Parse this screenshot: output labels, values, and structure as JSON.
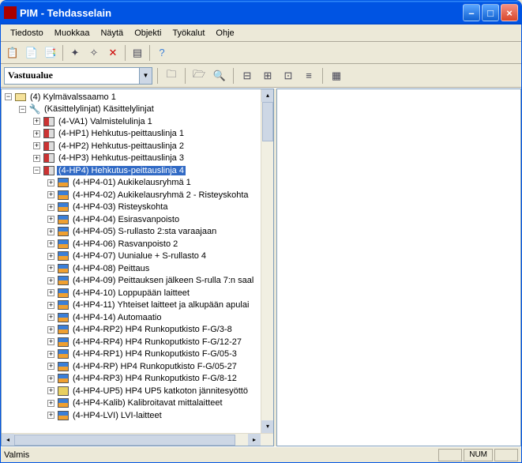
{
  "title": "PIM - Tehdasselain",
  "menu": [
    "Tiedosto",
    "Muokkaa",
    "Näytä",
    "Objekti",
    "Työkalut",
    "Ohje"
  ],
  "combo": "Vastuualue",
  "status": {
    "ready": "Valmis",
    "num": "NUM"
  },
  "tree": [
    {
      "depth": 0,
      "exp": "-",
      "icon": "root",
      "text": "(4) Kylmävalssaamo 1"
    },
    {
      "depth": 1,
      "exp": "-",
      "icon": "wrench",
      "text": "(Käsittelylinjat)  Käsittelylinjat"
    },
    {
      "depth": 2,
      "exp": "+",
      "icon": "factory",
      "text": "(4-VA1)  Valmistelulinja 1"
    },
    {
      "depth": 2,
      "exp": "+",
      "icon": "factory",
      "text": "(4-HP1)  Hehkutus-peittauslinja 1"
    },
    {
      "depth": 2,
      "exp": "+",
      "icon": "factory",
      "text": "(4-HP2)  Hehkutus-peittauslinja 2"
    },
    {
      "depth": 2,
      "exp": "+",
      "icon": "factory",
      "text": "(4-HP3)  Hehkutus-peittauslinja 3"
    },
    {
      "depth": 2,
      "exp": "-",
      "icon": "factory",
      "text": "(4-HP4)  Hehkutus-peittauslinja 4",
      "selected": true
    },
    {
      "depth": 3,
      "exp": "+",
      "icon": "equip",
      "text": "(4-HP4-01)  Aukikelausryhmä 1"
    },
    {
      "depth": 3,
      "exp": "+",
      "icon": "equip",
      "text": "(4-HP4-02)  Aukikelausryhmä 2 - Risteyskohta"
    },
    {
      "depth": 3,
      "exp": "+",
      "icon": "equip",
      "text": "(4-HP4-03)  Risteyskohta"
    },
    {
      "depth": 3,
      "exp": "+",
      "icon": "equip",
      "text": "(4-HP4-04)  Esirasvanpoisto"
    },
    {
      "depth": 3,
      "exp": "+",
      "icon": "equip",
      "text": "(4-HP4-05)  S-rullasto 2:sta varaajaan"
    },
    {
      "depth": 3,
      "exp": "+",
      "icon": "equip",
      "text": "(4-HP4-06)  Rasvanpoisto 2"
    },
    {
      "depth": 3,
      "exp": "+",
      "icon": "equip",
      "text": "(4-HP4-07)  Uunialue + S-rullasto 4"
    },
    {
      "depth": 3,
      "exp": "+",
      "icon": "equip",
      "text": "(4-HP4-08)  Peittaus"
    },
    {
      "depth": 3,
      "exp": "+",
      "icon": "equip",
      "text": "(4-HP4-09)  Peittauksen jälkeen S-rulla 7:n saal"
    },
    {
      "depth": 3,
      "exp": "+",
      "icon": "equip",
      "text": "(4-HP4-10)  Loppupään laitteet"
    },
    {
      "depth": 3,
      "exp": "+",
      "icon": "equip",
      "text": "(4-HP4-11)  Yhteiset laitteet ja alkupään apulai"
    },
    {
      "depth": 3,
      "exp": "+",
      "icon": "equip",
      "text": "(4-HP4-14)  Automaatio"
    },
    {
      "depth": 3,
      "exp": "+",
      "icon": "equip",
      "text": "(4-HP4-RP2)  HP4 Runkoputkisto F-G/3-8"
    },
    {
      "depth": 3,
      "exp": "+",
      "icon": "equip",
      "text": "(4-HP4-RP4)  HP4 Runkoputkisto F-G/12-27"
    },
    {
      "depth": 3,
      "exp": "+",
      "icon": "equip",
      "text": "(4-HP4-RP1)  HP4 Runkoputkisto F-G/05-3"
    },
    {
      "depth": 3,
      "exp": "+",
      "icon": "equip",
      "text": "(4-HP4-RP)  HP4 Runkoputkisto F-G/05-27"
    },
    {
      "depth": 3,
      "exp": "+",
      "icon": "equip",
      "text": "(4-HP4-RP3)  HP4 Runkoputkisto F-G/8-12"
    },
    {
      "depth": 3,
      "exp": "+",
      "icon": "calib",
      "text": "(4-HP4-UP5)  HP4 UP5 katkoton jännitesyöttö"
    },
    {
      "depth": 3,
      "exp": "+",
      "icon": "equip",
      "text": "(4-HP4-Kalib)  Kalibroitavat mittalaitteet"
    },
    {
      "depth": 3,
      "exp": "+",
      "icon": "equip",
      "text": "(4-HP4-LVI)  LVI-laitteet"
    }
  ]
}
